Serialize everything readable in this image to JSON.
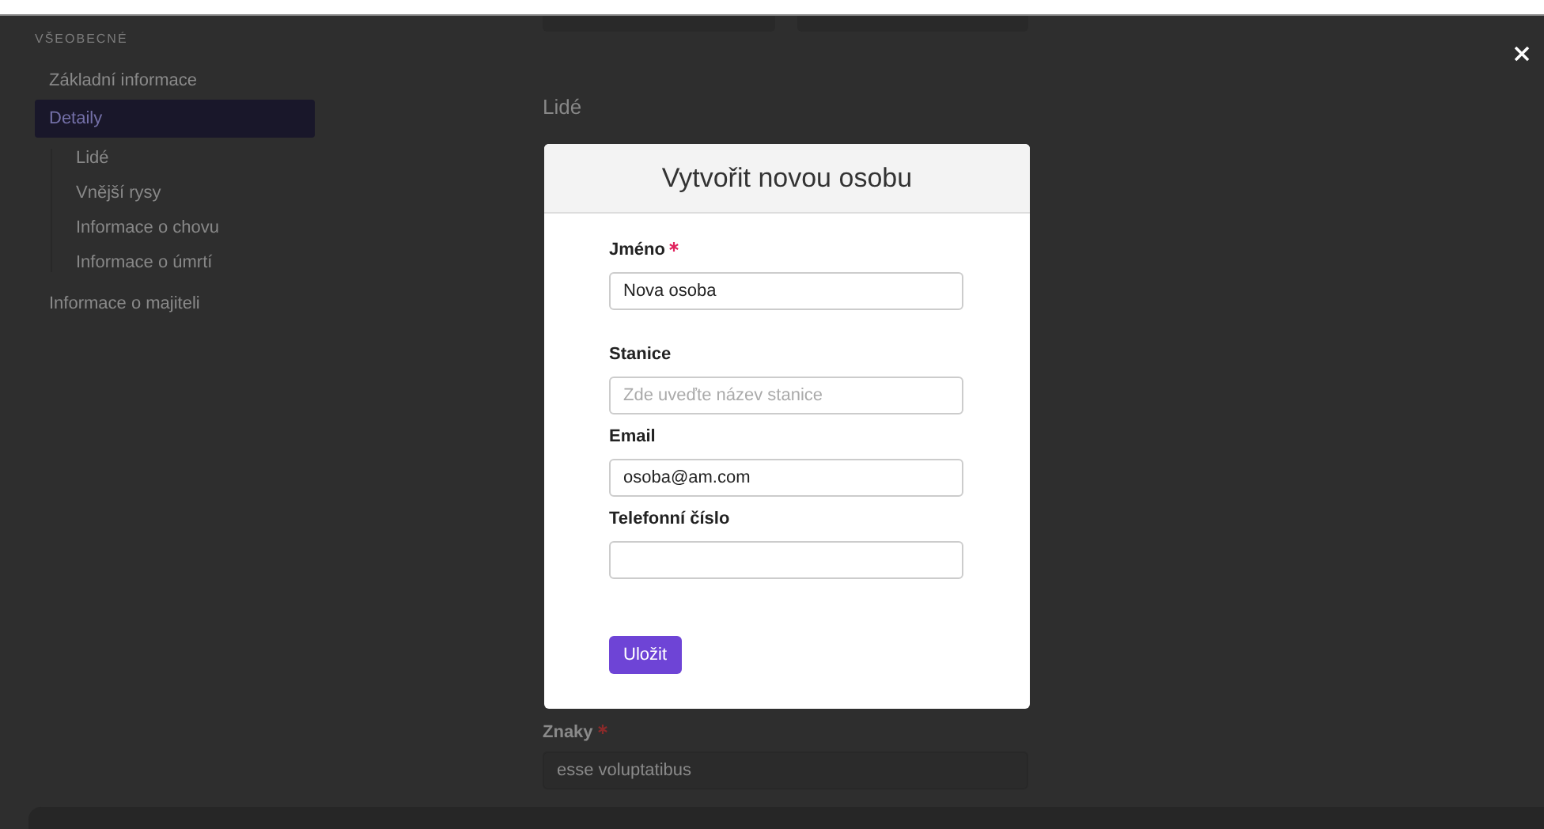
{
  "sidebar": {
    "section_title": "VŠEOBECNÉ",
    "items": [
      {
        "label": "Základní informace",
        "selected": false
      },
      {
        "label": "Detaily",
        "selected": true,
        "children": [
          {
            "label": "Lidé"
          },
          {
            "label": "Vnější rysy"
          },
          {
            "label": "Informace o chovu"
          },
          {
            "label": "Informace o úmrtí"
          }
        ]
      },
      {
        "label": "Informace o majiteli",
        "selected": false
      }
    ]
  },
  "content": {
    "heading": "Lidé",
    "field": {
      "label": "Znaky",
      "required": true,
      "value": "esse voluptatibus"
    }
  },
  "modal": {
    "title": "Vytvořit novou osobu",
    "fields": [
      {
        "label": "Jméno",
        "required": true,
        "value": "Nova osoba"
      },
      {
        "label": "Stanice",
        "required": false,
        "placeholder": "Zde uveďte název stanice"
      },
      {
        "label": "Email",
        "required": false,
        "value": "osoba@am.com"
      },
      {
        "label": "Telefonní číslo",
        "required": false
      }
    ],
    "button": "Uložit"
  }
}
